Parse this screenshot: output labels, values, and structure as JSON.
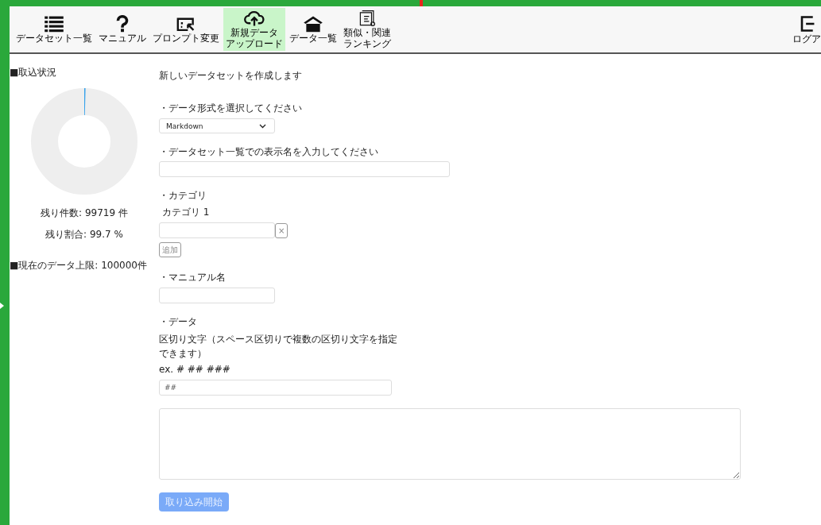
{
  "toolbar": {
    "items": [
      {
        "kind": "list",
        "lines": [
          "データセット一覧"
        ],
        "selected": false
      },
      {
        "kind": "help",
        "lines": [
          "マニュアル"
        ],
        "selected": false
      },
      {
        "kind": "prompt",
        "lines": [
          "プロンプト変更"
        ],
        "selected": false
      },
      {
        "kind": "upload",
        "lines": [
          "新規データ",
          "アップロード"
        ],
        "selected": true
      },
      {
        "kind": "home",
        "lines": [
          "データ一覧"
        ],
        "selected": false
      },
      {
        "kind": "ranking",
        "lines": [
          "類似・関連",
          "ランキング"
        ],
        "selected": false
      }
    ],
    "logout": {
      "label": "ログア"
    }
  },
  "sidebar": {
    "heading": "■取込状況",
    "usage": {
      "level": 0.003
    },
    "remaining_count": "残り件数: 99719 件",
    "remaining_ratio": "残り割合: 99.7 %",
    "limit": "■現在のデータ上限: 100000件"
  },
  "form": {
    "intro": "新しいデータセットを作成します",
    "format_label": "・データ形式を選択してください",
    "format_value": "Markdown",
    "name_label": "・データセット一覧での表示名を入力してください",
    "category_label": "・カテゴリ",
    "categories": [
      {
        "label": "カテゴリ 1",
        "remove": "×"
      }
    ],
    "add_button": "追加",
    "manual_label": "・マニュアル名",
    "data_label": "・データ",
    "delimiter_help": "区切り文字（スペース区切りで複数の区切り文字を指定できます）",
    "delimiter_example": "ex. # ## ###",
    "delimiter_value": "##",
    "submit": "取り込み開始"
  }
}
